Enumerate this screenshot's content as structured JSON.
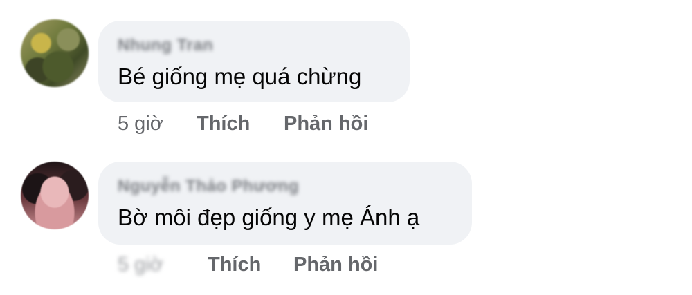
{
  "comments": [
    {
      "author": "Nhung Tran",
      "text": "Bé giống mẹ quá chừng",
      "time": "5 giờ",
      "like_label": "Thích",
      "reply_label": "Phản hồi"
    },
    {
      "author": "Nguyễn Thảo Phương",
      "text": "Bờ môi đẹp giống y mẹ Ánh ạ",
      "time": "5 giờ",
      "like_label": "Thích",
      "reply_label": "Phản hồi"
    }
  ],
  "colors": {
    "bubble_background": "#f0f2f5",
    "text": "#050505",
    "secondary_text": "#65676b"
  }
}
